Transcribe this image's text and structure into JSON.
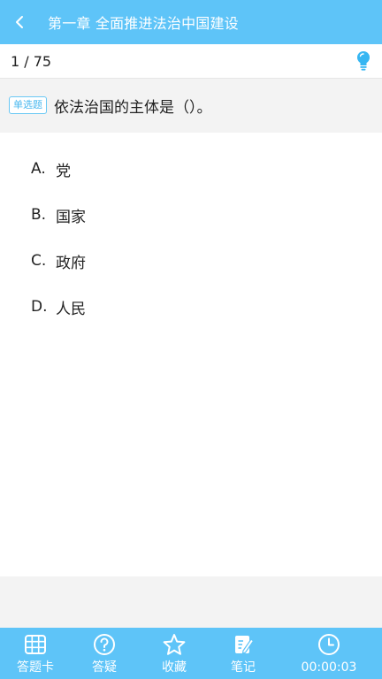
{
  "header": {
    "title": "第一章 全面推进法治中国建设"
  },
  "progress": {
    "text": "1 / 75",
    "current": 1,
    "total": 75
  },
  "question": {
    "type_badge": "单选题",
    "stem": "依法治国的主体是（）。"
  },
  "options": [
    {
      "letter": "A.",
      "text": "党"
    },
    {
      "letter": "B.",
      "text": "国家"
    },
    {
      "letter": "C.",
      "text": "政府"
    },
    {
      "letter": "D.",
      "text": "人民"
    }
  ],
  "footer": {
    "tabs": [
      {
        "label": "答题卡",
        "icon": "grid-card-icon"
      },
      {
        "label": "答疑",
        "icon": "question-circle-icon"
      },
      {
        "label": "收藏",
        "icon": "star-icon"
      },
      {
        "label": "笔记",
        "icon": "note-edit-icon"
      },
      {
        "label": "00:00:03",
        "icon": "clock-icon"
      }
    ]
  },
  "colors": {
    "accent": "#5ec4f8",
    "badge": "#4bb8ef",
    "hint_bulb": "#36b6f2",
    "background": "#f3f3f3",
    "panel": "#ffffff"
  }
}
